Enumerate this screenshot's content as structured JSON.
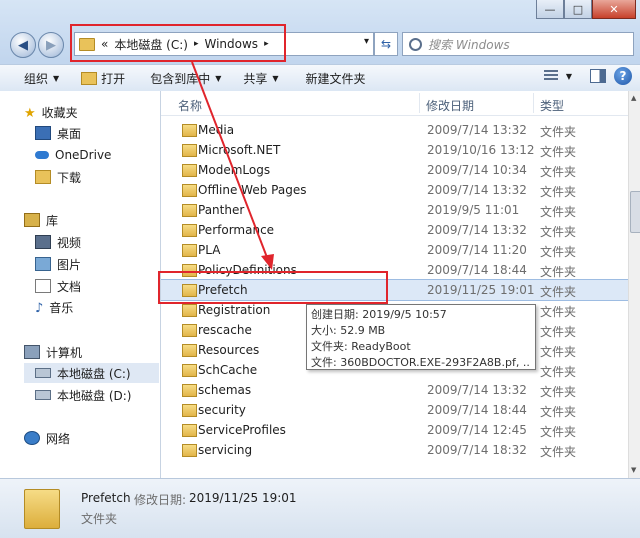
{
  "window": {
    "minimize": "—",
    "maximize": "□",
    "close": "✕"
  },
  "nav": {
    "back": "◀",
    "forward": "▶",
    "address": {
      "prefix": "«",
      "segments": [
        "本地磁盘 (C:)",
        "Windows"
      ],
      "sep": "▸",
      "dropdown": "▾"
    },
    "refresh": "⇆",
    "search_placeholder": "搜索 Windows"
  },
  "toolbar": {
    "organize": "组织",
    "open": "打开",
    "include": "包含到库中",
    "share": "共享",
    "new_folder": "新建文件夹",
    "help": "?"
  },
  "sidebar": {
    "favorites": "收藏夹",
    "desktop": "桌面",
    "onedrive": "OneDrive",
    "downloads": "下载",
    "libraries": "库",
    "videos": "视频",
    "pictures": "图片",
    "documents": "文档",
    "music": "音乐",
    "computer": "计算机",
    "drive_c": "本地磁盘 (C:)",
    "drive_d": "本地磁盘 (D:)",
    "network": "网络"
  },
  "columns": {
    "name": "名称",
    "date": "修改日期",
    "type": "类型"
  },
  "files": [
    {
      "name": "Media",
      "date": "2009/7/14 13:32",
      "type": "文件夹"
    },
    {
      "name": "Microsoft.NET",
      "date": "2019/10/16 13:12",
      "type": "文件夹"
    },
    {
      "name": "ModemLogs",
      "date": "2009/7/14 10:34",
      "type": "文件夹"
    },
    {
      "name": "Offline Web Pages",
      "date": "2009/7/14 13:32",
      "type": "文件夹"
    },
    {
      "name": "Panther",
      "date": "2019/9/5 11:01",
      "type": "文件夹"
    },
    {
      "name": "Performance",
      "date": "2009/7/14 13:32",
      "type": "文件夹"
    },
    {
      "name": "PLA",
      "date": "2009/7/14 11:20",
      "type": "文件夹"
    },
    {
      "name": "PolicyDefinitions",
      "date": "2009/7/14 18:44",
      "type": "文件夹"
    },
    {
      "name": "Prefetch",
      "date": "2019/11/25 19:01",
      "type": "文件夹"
    },
    {
      "name": "Registration",
      "date": "",
      "type": "文件夹"
    },
    {
      "name": "rescache",
      "date": "",
      "type": "文件夹"
    },
    {
      "name": "Resources",
      "date": "",
      "type": "文件夹"
    },
    {
      "name": "SchCache",
      "date": "",
      "type": "文件夹"
    },
    {
      "name": "schemas",
      "date": "2009/7/14 13:32",
      "type": "文件夹"
    },
    {
      "name": "security",
      "date": "2009/7/14 18:44",
      "type": "文件夹"
    },
    {
      "name": "ServiceProfiles",
      "date": "2009/7/14 12:45",
      "type": "文件夹"
    },
    {
      "name": "servicing",
      "date": "2009/7/14 18:32",
      "type": "文件夹"
    }
  ],
  "tooltip": {
    "created": "创建日期: 2019/9/5 10:57",
    "size": "大小: 52.9 MB",
    "folders": "文件夹: ReadyBoot",
    "files": "文件: 360BDOCTOR.EXE-293F2A8B.pf, ..."
  },
  "details": {
    "name": "Prefetch",
    "date_label": "修改日期:",
    "date_value": "2019/11/25 19:01",
    "type": "文件夹"
  },
  "colors": {
    "annotation": "#e0252c",
    "selection": "#dce8f7"
  }
}
